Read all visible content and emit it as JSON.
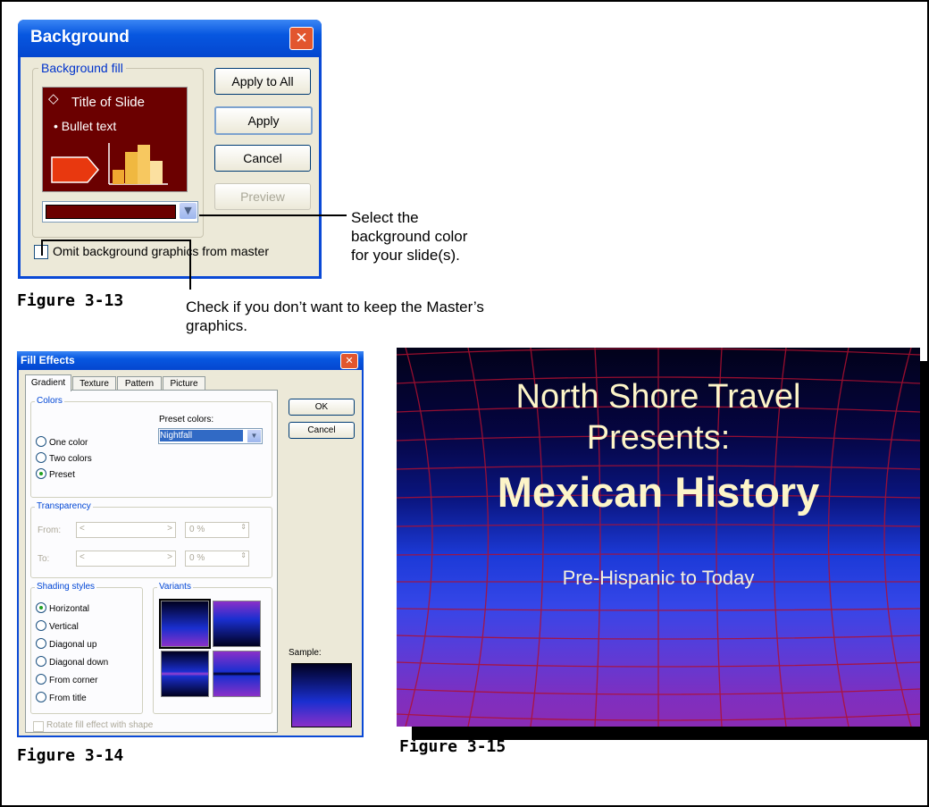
{
  "background_dialog": {
    "title": "Background",
    "group_label": "Background fill",
    "preview_title": "Title of Slide",
    "preview_bullet": "• Bullet text",
    "buttons": {
      "apply_to_all": "Apply to All",
      "apply": "Apply",
      "cancel": "Cancel",
      "preview": "Preview"
    },
    "omit_checkbox": "Omit background graphics from master",
    "selected_color": "#6b0000"
  },
  "callouts": {
    "select_color": "Select the background color for your slide(s).",
    "check_master": "Check if you don’t want to keep the Master’s graphics."
  },
  "figures": {
    "f13": "Figure 3-13",
    "f14": "Figure 3-14",
    "f15": "Figure 3-15"
  },
  "fill_effects_dialog": {
    "title": "Fill Effects",
    "tabs": [
      "Gradient",
      "Texture",
      "Pattern",
      "Picture"
    ],
    "active_tab": "Gradient",
    "colors_group": "Colors",
    "color_options": [
      "One color",
      "Two colors",
      "Preset"
    ],
    "selected_color_option": "Preset",
    "preset_label": "Preset colors:",
    "preset_value": "Nightfall",
    "transparency_group": "Transparency",
    "from_label": "From:",
    "to_label": "To:",
    "from_value": "0 %",
    "to_value": "0 %",
    "shading_group": "Shading styles",
    "shading_options": [
      "Horizontal",
      "Vertical",
      "Diagonal up",
      "Diagonal down",
      "From corner",
      "From title"
    ],
    "selected_shading": "Horizontal",
    "variants_group": "Variants",
    "sample_label": "Sample:",
    "rotate_checkbox": "Rotate fill effect with shape",
    "ok": "OK",
    "cancel": "Cancel"
  },
  "slide": {
    "line1": "North Shore Travel",
    "line2": "Presents:",
    "title": "Mexican History",
    "subtitle": "Pre-Hispanic to Today"
  }
}
